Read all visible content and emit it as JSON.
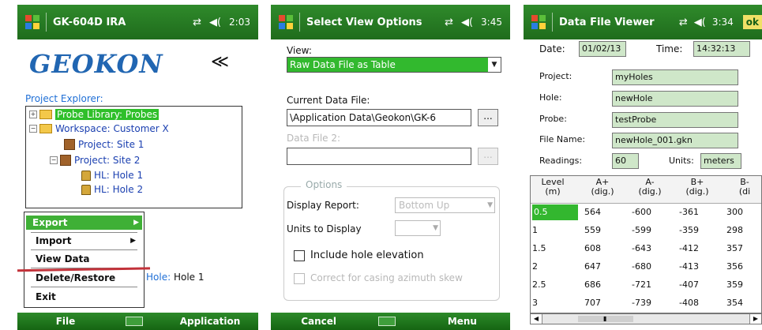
{
  "panel1": {
    "title": "GK-604D IRA",
    "time": "2:03",
    "logo": "GEOKON",
    "back_icon": "back-arrows-icon",
    "project_explorer": "Project Explorer:",
    "tree": [
      {
        "label": "Probe Library: Probes",
        "selected": true
      },
      {
        "label": "Workspace: Customer X"
      },
      {
        "label": "Project: Site 1"
      },
      {
        "label": "Project: Site 2"
      },
      {
        "label": "HL: Hole 1"
      },
      {
        "label": "HL: Hole 2"
      }
    ],
    "menu": [
      {
        "label": "Export",
        "selected": true,
        "submenu": true
      },
      {
        "label": "Import",
        "submenu": true
      },
      {
        "label": "View Data"
      },
      {
        "label": "Delete/Restore"
      },
      {
        "label": "Exit"
      }
    ],
    "hole_label_prefix": "Hole:",
    "hole_label_value": "Hole 1",
    "bottom_left": "File",
    "bottom_right": "Application"
  },
  "panel2": {
    "title": "Select View Options",
    "time": "3:45",
    "view_label": "View:",
    "view_value": "Raw Data File as Table",
    "current_label": "Current Data File:",
    "current_value": "\\Application Data\\Geokon\\GK-6",
    "browse": "...",
    "data2_label": "Data File 2:",
    "options_legend": "Options",
    "display_report_label": "Display Report:",
    "display_report_value": "Bottom Up",
    "units_label": "Units to Display",
    "include_elev": "Include hole elevation",
    "correct_casing": "Correct for casing azimuth skew",
    "bottom_left": "Cancel",
    "bottom_right": "Menu"
  },
  "panel3": {
    "title": "Data File Viewer",
    "time": "3:34",
    "ok": "ok",
    "date_label": "Date:",
    "date_value": "01/02/13",
    "time_label": "Time:",
    "time_value": "14:32:13",
    "project_label": "Project:",
    "project_value": "myHoles",
    "hole_label": "Hole:",
    "hole_value": "newHole",
    "probe_label": "Probe:",
    "probe_value": "testProbe",
    "file_label": "File Name:",
    "file_value": "newHole_001.gkn",
    "readings_label": "Readings:",
    "readings_value": "60",
    "units_label": "Units:",
    "units_value": "meters",
    "headers": [
      {
        "top": "Level",
        "bottom": "(m)"
      },
      {
        "top": "A+",
        "bottom": "(dig.)"
      },
      {
        "top": "A-",
        "bottom": "(dig.)"
      },
      {
        "top": "B+",
        "bottom": "(dig.)"
      },
      {
        "top": "B-",
        "bottom": "(di"
      }
    ],
    "rows": [
      [
        "0.5",
        "564",
        "-600",
        "-361",
        "300"
      ],
      [
        "1",
        "559",
        "-599",
        "-359",
        "298"
      ],
      [
        "1.5",
        "608",
        "-643",
        "-412",
        "357"
      ],
      [
        "2",
        "647",
        "-680",
        "-413",
        "356"
      ],
      [
        "2.5",
        "686",
        "-721",
        "-407",
        "359"
      ],
      [
        "3",
        "707",
        "-739",
        "-408",
        "354"
      ]
    ]
  }
}
